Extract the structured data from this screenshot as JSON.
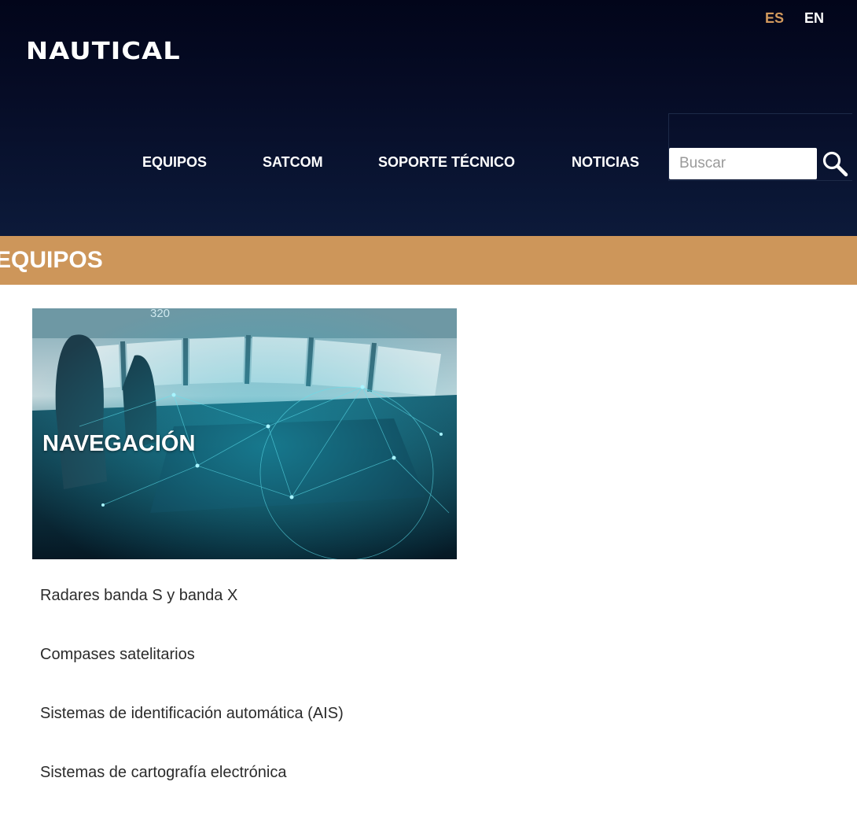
{
  "header": {
    "languages": [
      {
        "label": "ES",
        "active": true
      },
      {
        "label": "EN",
        "active": false
      }
    ],
    "logo_text": "NAUTICAL",
    "nav": [
      "EQUIPOS",
      "SATCOM",
      "SOPORTE TÉCNICO",
      "NOTICIAS"
    ],
    "search": {
      "placeholder": "Buscar",
      "value": "",
      "icon": "search-icon"
    }
  },
  "section": {
    "title": "EQUIPOS"
  },
  "card": {
    "title": "NAVEGACIÓN",
    "image_overlay_text": "320",
    "items": [
      "Radares banda S y banda X",
      "Compases satelitarios",
      "Sistemas de identificación automática (AIS)",
      "Sistemas de cartografía electrónica"
    ]
  },
  "colors": {
    "accent": "#cd965a",
    "active_language": "#d2995d",
    "header_dark": "#02051a",
    "header_light": "#0c1a3a",
    "text": "#2b2b2b"
  }
}
